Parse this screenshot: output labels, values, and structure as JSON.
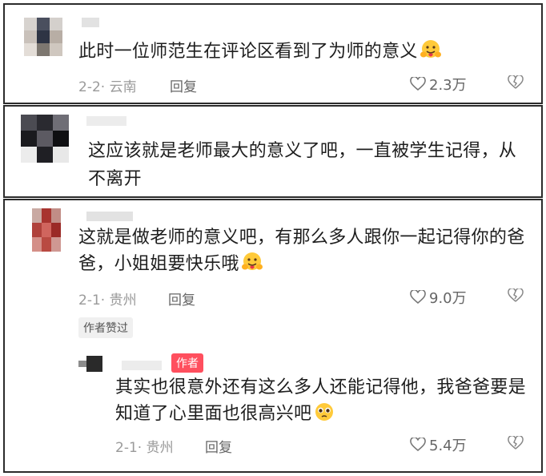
{
  "comments": [
    {
      "text": "此时一位师范生在评论区看到了为师的意义",
      "date_location": "2-2· 云南",
      "reply_label": "回复",
      "likes": "2.3万",
      "emoji": "hug-face-emoji"
    },
    {
      "text": "这应该就是老师最大的意义了吧，一直被学生记得，从不离开"
    },
    {
      "text": "这就是做老师的意义吧，有那么多人跟你一起记得你的爸爸，小姐姐要快乐哦",
      "date_location": "2-1· 贵州",
      "reply_label": "回复",
      "likes": "9.0万",
      "author_liked_badge": "作者赞过",
      "emoji": "hug-face-emoji"
    }
  ],
  "reply": {
    "author_badge": "作者",
    "text": "其实也很意外还有这么多人还能记得他，我爸爸要是知道了心里面也很高兴吧",
    "date_location": "2-1· 贵州",
    "reply_label": "回复",
    "likes": "5.4万",
    "emoji": "pleading-face-emoji"
  },
  "colors": {
    "border": "#2b2b2b",
    "meta_gray": "#9a9a9a",
    "author_badge_bg": "#ff4f5e"
  }
}
